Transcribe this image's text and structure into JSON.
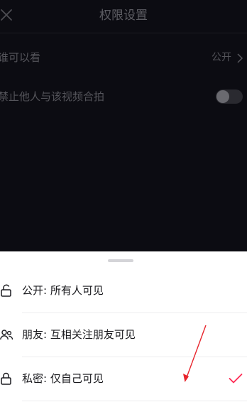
{
  "header": {
    "title": "权限设置",
    "close_icon": "close-icon"
  },
  "settings": {
    "visibility": {
      "label": "谁可以看",
      "value": "公开"
    },
    "duet": {
      "label": "禁止他人与该视频合拍",
      "enabled": false
    }
  },
  "visibility_sheet": {
    "options": [
      {
        "icon": "unlock-icon",
        "label": "公开: 所有人可见",
        "selected": false
      },
      {
        "icon": "friends-icon",
        "label": "朋友: 互相关注朋友可见",
        "selected": false
      },
      {
        "icon": "lock-icon",
        "label": "私密: 仅自己可见",
        "selected": true
      }
    ]
  },
  "colors": {
    "background": "#0c0c12",
    "sheet": "#ffffff",
    "accent": "#fe2c55",
    "annotation": "#e8252d"
  }
}
